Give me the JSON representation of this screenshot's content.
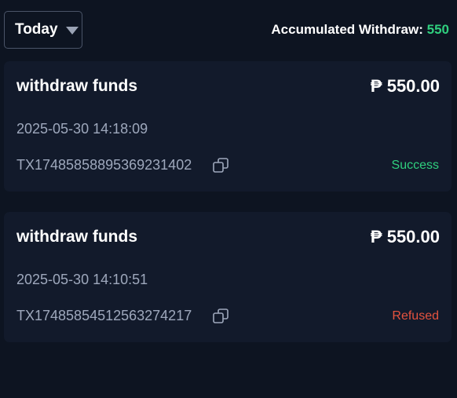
{
  "filter": {
    "label": "Today"
  },
  "summary": {
    "label": "Accumulated Withdraw:",
    "value": "550"
  },
  "records": [
    {
      "title": "withdraw funds",
      "amount": "₱ 550.00",
      "datetime": "2025-05-30 14:18:09",
      "tx_id": "TX17485858895369231402",
      "status": "Success"
    },
    {
      "title": "withdraw funds",
      "amount": "₱ 550.00",
      "datetime": "2025-05-30 14:10:51",
      "tx_id": "TX17485854512563274217",
      "status": "Refused"
    }
  ],
  "colors": {
    "background": "#0d1421",
    "card": "#121a2b",
    "accent_green": "#2fcf7e",
    "refused_red": "#e5533f",
    "muted_text": "#9ea8bc"
  },
  "icons": {
    "filter_caret": "chevron-down-icon",
    "copy": "copy-icon"
  }
}
